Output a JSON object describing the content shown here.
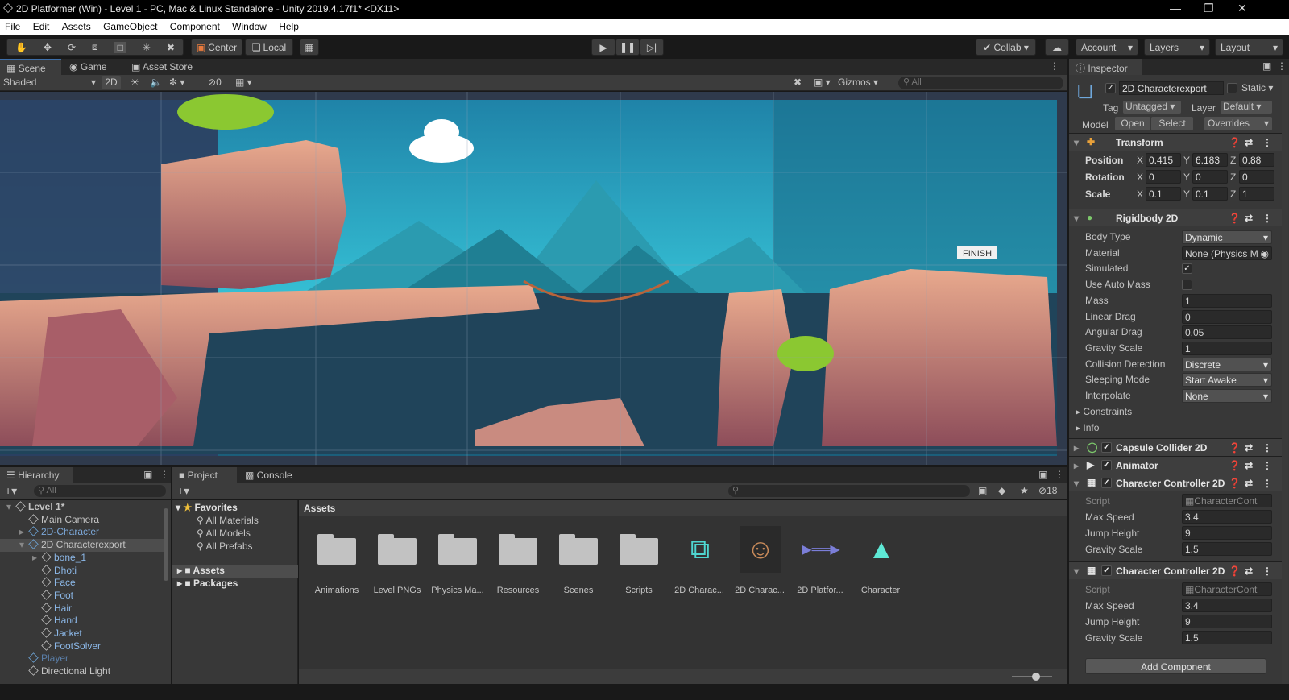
{
  "window": {
    "title": "2D Platformer (Win) - Level 1 - PC, Mac & Linux Standalone - Unity 2019.4.17f1* <DX11>"
  },
  "menu": [
    "File",
    "Edit",
    "Assets",
    "GameObject",
    "Component",
    "Window",
    "Help"
  ],
  "toolbar": {
    "pivot": "Center",
    "space": "Local",
    "collab": "Collab",
    "account": "Account",
    "layers": "Layers",
    "layout": "Layout"
  },
  "scene_tabs": [
    "Scene",
    "Game",
    "Asset Store"
  ],
  "scene_bar": {
    "shading": "Shaded",
    "mode_2d": "2D",
    "hidden_count": "0",
    "gizmos": "Gizmos",
    "search_placeholder": "All"
  },
  "scene_view": {
    "sign_text": "FINISH"
  },
  "hierarchy": {
    "tab": "Hierarchy",
    "search_placeholder": "All",
    "items": [
      {
        "label": "Level 1*",
        "depth": 0,
        "expanded": true,
        "type": "scene"
      },
      {
        "label": "Main Camera",
        "depth": 1
      },
      {
        "label": "2D-Character",
        "depth": 1,
        "collapsed": true,
        "prefab": true
      },
      {
        "label": "2D Characterexport",
        "depth": 1,
        "expanded": true,
        "selected": true
      },
      {
        "label": "bone_1",
        "depth": 2,
        "collapsed": true
      },
      {
        "label": "Dhoti",
        "depth": 2
      },
      {
        "label": "Face",
        "depth": 2
      },
      {
        "label": "Foot",
        "depth": 2
      },
      {
        "label": "Hair",
        "depth": 2
      },
      {
        "label": "Hand",
        "depth": 2
      },
      {
        "label": "Jacket",
        "depth": 2
      },
      {
        "label": "FootSolver",
        "depth": 2
      },
      {
        "label": "Player",
        "depth": 1,
        "prefab": true,
        "dim": true
      },
      {
        "label": "Directional Light",
        "depth": 1
      }
    ]
  },
  "project": {
    "tabs": [
      "Project",
      "Console"
    ],
    "hidden_count": "18",
    "favorites": {
      "label": "Favorites",
      "items": [
        "All Materials",
        "All Models",
        "All Prefabs"
      ]
    },
    "roots": [
      "Assets",
      "Packages"
    ],
    "breadcrumb": "Assets",
    "assets": [
      "Animations",
      "Level PNGs",
      "Physics Ma...",
      "Resources",
      "Scenes",
      "Scripts",
      "2D Charac...",
      "2D Charac...",
      "2D Platfor...",
      "Character"
    ]
  },
  "inspector": {
    "tab": "Inspector",
    "object_name": "2D Characterexport",
    "static_label": "Static",
    "tag_label": "Tag",
    "tag": "Untagged",
    "layer_label": "Layer",
    "layer": "Default",
    "model_label": "Model",
    "open": "Open",
    "select": "Select",
    "overrides": "Overrides",
    "transform": {
      "title": "Transform",
      "position_label": "Position",
      "position": {
        "x": "0.415",
        "y": "6.183",
        "z": "0.88"
      },
      "rotation_label": "Rotation",
      "rotation": {
        "x": "0",
        "y": "0",
        "z": "0"
      },
      "scale_label": "Scale",
      "scale": {
        "x": "0.1",
        "y": "0.1",
        "z": "1"
      }
    },
    "rigidbody": {
      "title": "Rigidbody 2D",
      "rows": [
        {
          "label": "Body Type",
          "value": "Dynamic",
          "kind": "drop"
        },
        {
          "label": "Material",
          "value": "None (Physics M",
          "kind": "obj"
        },
        {
          "label": "Simulated",
          "value": "✓",
          "kind": "check"
        },
        {
          "label": "Use Auto Mass",
          "value": "",
          "kind": "check"
        },
        {
          "label": "Mass",
          "value": "1",
          "kind": "field"
        },
        {
          "label": "Linear Drag",
          "value": "0",
          "kind": "field"
        },
        {
          "label": "Angular Drag",
          "value": "0.05",
          "kind": "field"
        },
        {
          "label": "Gravity Scale",
          "value": "1",
          "kind": "field"
        },
        {
          "label": "Collision Detection",
          "value": "Discrete",
          "kind": "drop"
        },
        {
          "label": "Sleeping Mode",
          "value": "Start Awake",
          "kind": "drop"
        },
        {
          "label": "Interpolate",
          "value": "None",
          "kind": "drop"
        }
      ],
      "constraints": "Constraints",
      "info": "Info"
    },
    "capsule": {
      "title": "Capsule Collider 2D"
    },
    "animator": {
      "title": "Animator"
    },
    "controller1": {
      "title": "Character Controller 2D",
      "script_label": "Script",
      "script": "CharacterCont",
      "max_speed_label": "Max Speed",
      "max_speed": "3.4",
      "jump_label": "Jump Height",
      "jump": "9",
      "gravity_label": "Gravity Scale",
      "gravity": "1.5"
    },
    "controller2": {
      "title": "Character Controller 2D",
      "script_label": "Script",
      "script": "CharacterCont",
      "max_speed_label": "Max Speed",
      "max_speed": "3.4",
      "jump_label": "Jump Height",
      "jump": "9",
      "gravity_label": "Gravity Scale",
      "gravity": "1.5"
    },
    "add_component": "Add Component"
  },
  "colors": {
    "accent": "#3d6ea8",
    "panel": "#383838",
    "dark": "#191919"
  }
}
